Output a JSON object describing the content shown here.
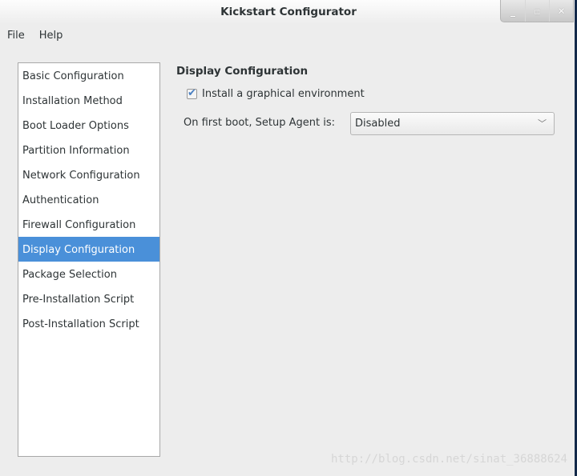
{
  "window": {
    "title": "Kickstart Configurator",
    "controls": [
      "minimize-icon",
      "maximize-icon",
      "close-icon"
    ]
  },
  "menu": [
    "File",
    "Help"
  ],
  "sidebar": {
    "items": [
      "Basic Configuration",
      "Installation Method",
      "Boot Loader Options",
      "Partition Information",
      "Network Configuration",
      "Authentication",
      "Firewall Configuration",
      "Display Configuration",
      "Package Selection",
      "Pre-Installation Script",
      "Post-Installation Script"
    ],
    "selected_index": 7,
    "selected_color": "#4a90d9"
  },
  "main": {
    "heading": "Display Configuration",
    "install_graphical": {
      "label": "Install a graphical environment",
      "checked": true
    },
    "setup_agent": {
      "label": "On first boot, Setup Agent is:",
      "value": "Disabled"
    }
  },
  "watermark": "http://blog.csdn.net/sinat_36888624"
}
